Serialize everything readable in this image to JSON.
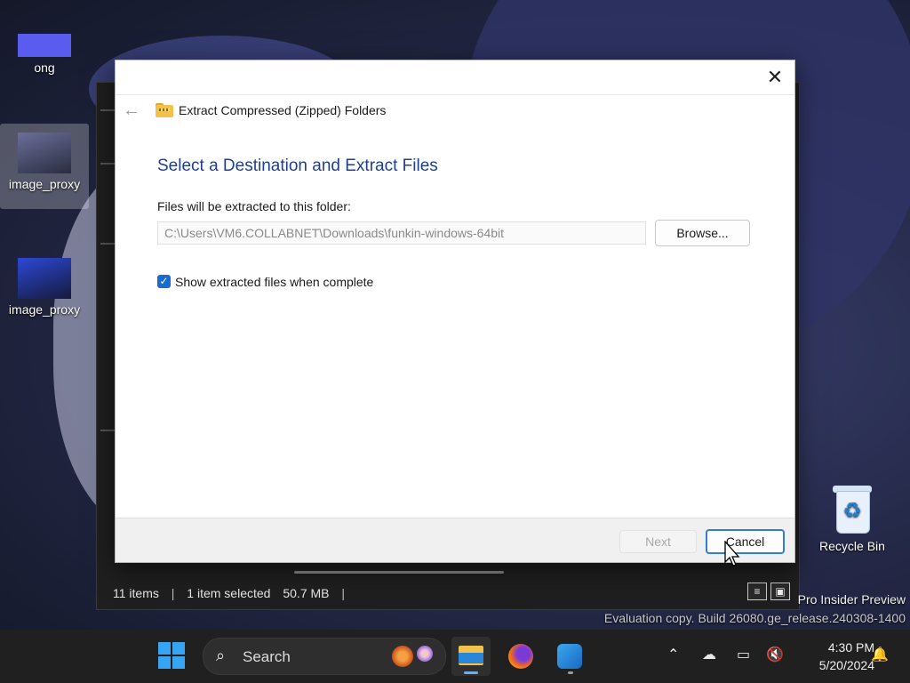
{
  "desktop": {
    "icons": [
      {
        "label": "ong"
      },
      {
        "label": "image_proxy"
      },
      {
        "label": "image_proxy"
      }
    ],
    "recycle_bin": {
      "label": "Recycle Bin"
    }
  },
  "explorer": {
    "status": {
      "items": "11 items",
      "sep1": "|",
      "selected": "1 item selected",
      "size": "50.7 MB",
      "sep2": "|"
    }
  },
  "dialog": {
    "title": "Extract Compressed (Zipped) Folders",
    "heading": "Select a Destination and Extract Files",
    "folder_label": "Files will be extracted to this folder:",
    "path_value": "C:\\Users\\VM6.COLLABNET\\Downloads\\funkin-windows-64bit",
    "browse_label": "Browse...",
    "checkbox": {
      "checked": true,
      "label": "Show extracted files when complete"
    },
    "next_label": "Next",
    "cancel_label": "Cancel"
  },
  "watermark": {
    "line1": "Pro Insider Preview",
    "line2": "Evaluation copy. Build 26080.ge_release.240308-1400"
  },
  "taskbar": {
    "search_label": "Search",
    "apps": [
      {
        "icon": "file-explorer-icon",
        "active": true
      },
      {
        "icon": "firefox-icon",
        "active": false
      },
      {
        "icon": "paint-icon",
        "active": false
      }
    ],
    "tray": {
      "time": "4:30 PM",
      "date": "5/20/2024"
    }
  }
}
